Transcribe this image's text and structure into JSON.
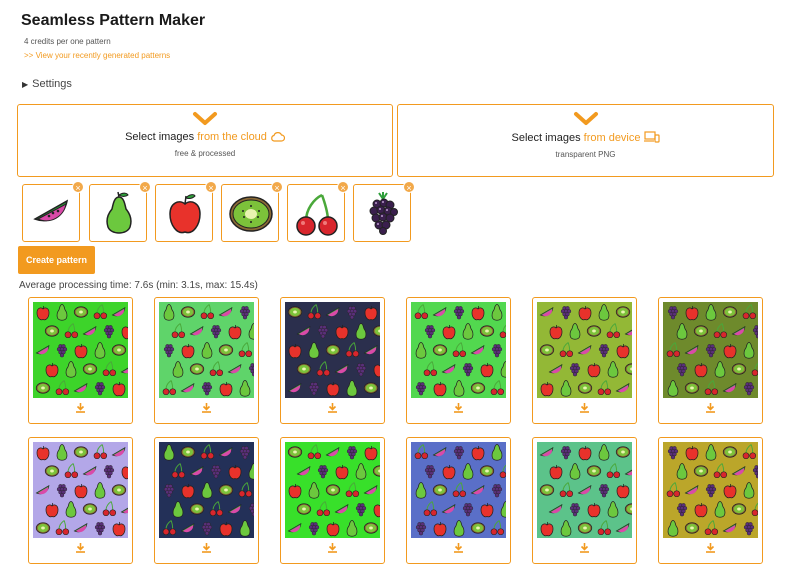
{
  "header": {
    "title": "Seamless Pattern Maker",
    "subtitle": "4 credits per one pattern",
    "recent_link": ">> View your recently generated patterns"
  },
  "settings": {
    "label": "Settings"
  },
  "upload": {
    "cloud": {
      "prefix": "Select images ",
      "accent": "from the cloud",
      "note": "free & processed"
    },
    "device": {
      "prefix": "Select images ",
      "accent": "from device",
      "note": "transparent PNG"
    }
  },
  "selected_images": [
    {
      "name": "watermelon-icon"
    },
    {
      "name": "pear-icon"
    },
    {
      "name": "apple-icon"
    },
    {
      "name": "kiwi-icon"
    },
    {
      "name": "cherry-icon"
    },
    {
      "name": "blackberry-icon"
    }
  ],
  "create_button": "Create pattern",
  "avg_time": "Average processing time: 7.6s (min: 3.1s, max: 15.4s)",
  "patterns": [
    {
      "bg": "#3dd42a"
    },
    {
      "bg": "#5fd46a"
    },
    {
      "bg": "#2b2f4d"
    },
    {
      "bg": "#52d84f"
    },
    {
      "bg": "#93b836"
    },
    {
      "bg": "#6e8a2c"
    },
    {
      "bg": "#b3a7e8"
    },
    {
      "bg": "#233058"
    },
    {
      "bg": "#38e02a"
    },
    {
      "bg": "#5a6fc8"
    },
    {
      "bg": "#5cc38a"
    },
    {
      "bg": "#bba62a"
    }
  ],
  "colors": {
    "accent": "#f29a1f"
  },
  "icons": {
    "download": "download-icon",
    "remove": "close-icon",
    "cloud": "cloud-icon",
    "device": "devices-icon",
    "chevron": "chevron-down-icon"
  }
}
